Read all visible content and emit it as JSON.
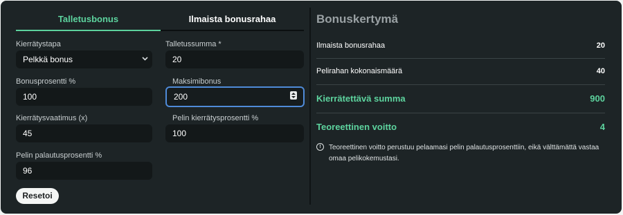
{
  "tabs": [
    "Talletusbonus",
    "Ilmaista bonusrahaa"
  ],
  "form": {
    "wagering_method": {
      "label": "Kierrätystapa",
      "value": "Pelkkä bonus"
    },
    "deposit_amount": {
      "label": "Talletussumma *",
      "value": "20"
    },
    "bonus_percent": {
      "label": "Bonusprosentti %",
      "value": "100"
    },
    "max_bonus": {
      "label": "Maksimibonus",
      "value": "200"
    },
    "wagering_requirement": {
      "label": "Kierrätysvaatimus (x)",
      "value": "45"
    },
    "game_contribution": {
      "label": "Pelin kierrätysprosentti %",
      "value": "100"
    },
    "rtp": {
      "label": "Pelin palautusprosentti %",
      "value": "96"
    },
    "reset_label": "Resetoi"
  },
  "summary": {
    "title": "Bonuskertymä",
    "rows": [
      {
        "label": "Ilmaista bonusrahaa",
        "value": "20"
      },
      {
        "label": "Pelirahan kokonaismäärä",
        "value": "40"
      }
    ],
    "wager_total": {
      "label": "Kierrätettävä summa",
      "value": "900"
    },
    "theoretical_win": {
      "label": "Teoreettinen voitto",
      "value": "4"
    },
    "note": "Teoreettinen voitto perustuu pelaamasi pelin palautusprosenttiin, eikä välttämättä vastaa omaa pelikokemustasi.",
    "note_icon_glyph": "!"
  },
  "colors": {
    "accent": "#5dd39e",
    "panel": "#1d2426",
    "focus": "#4f8bd9"
  }
}
